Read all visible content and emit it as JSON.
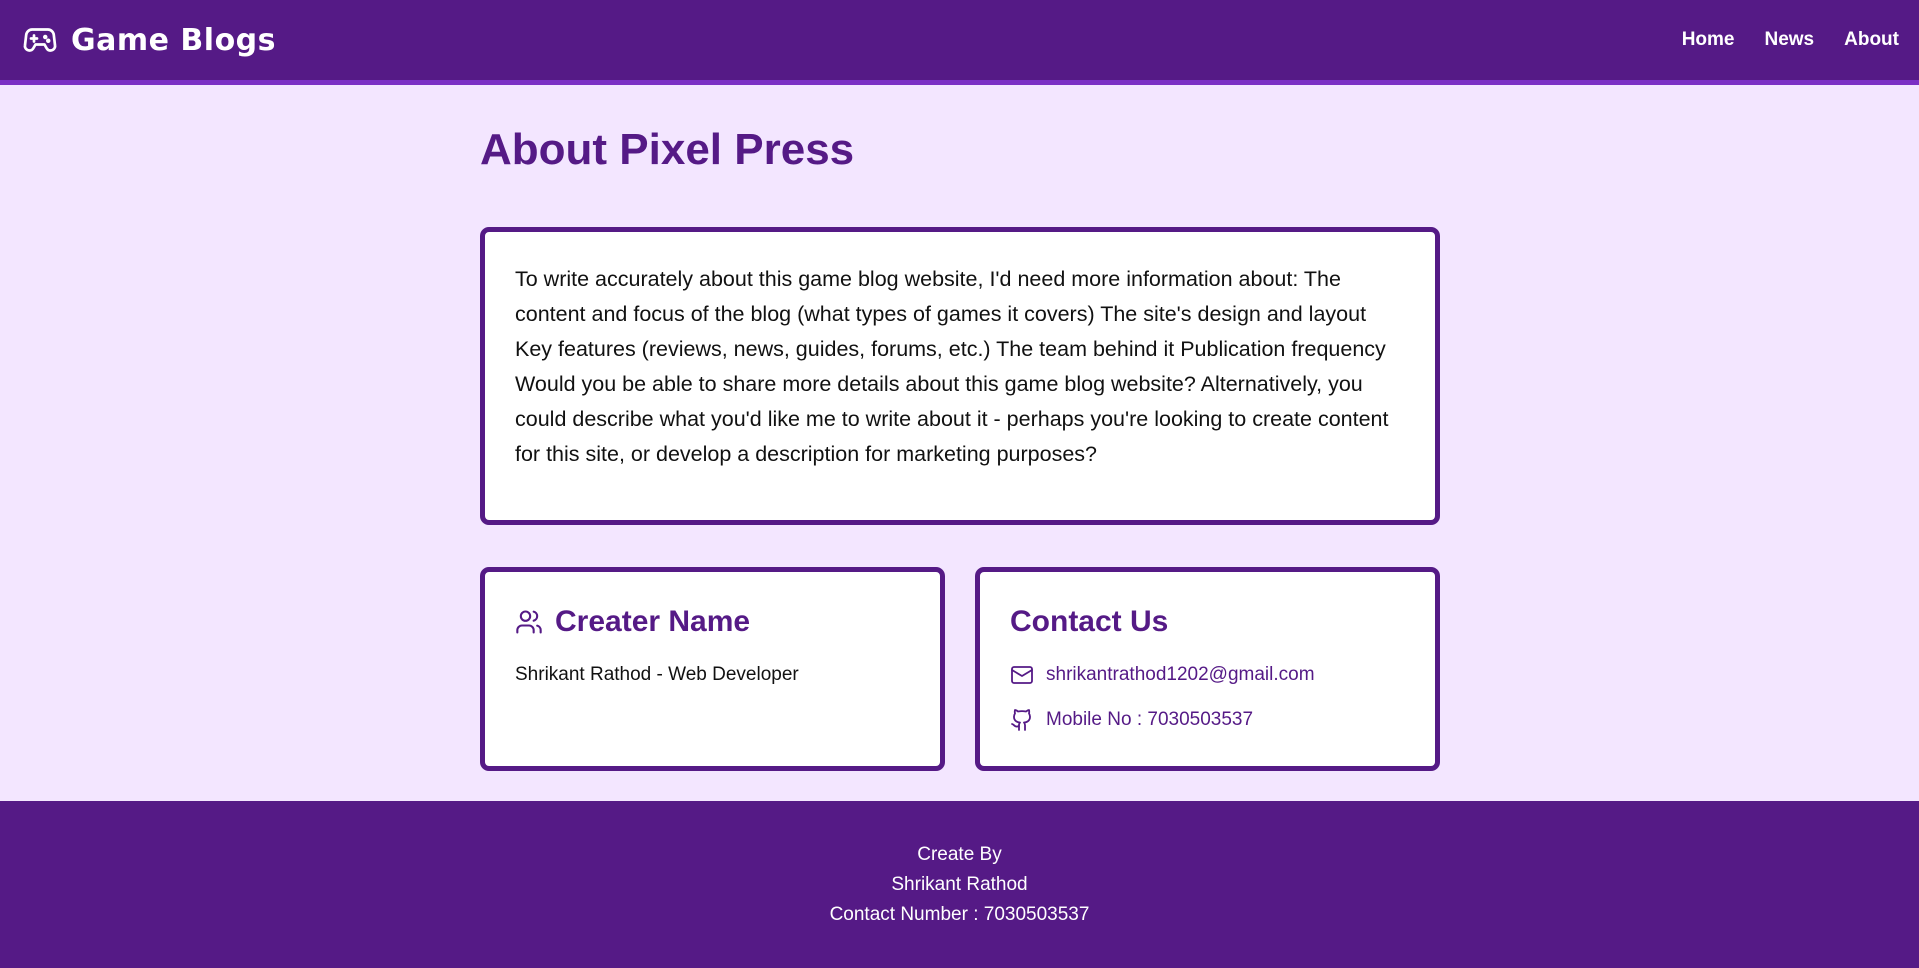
{
  "header": {
    "brand_icon": "gamepad-icon",
    "brand_title": "Game Blogs",
    "nav": [
      {
        "label": "Home"
      },
      {
        "label": "News"
      },
      {
        "label": "About"
      }
    ]
  },
  "main": {
    "title": "About Pixel Press",
    "about_text": "To write accurately about this game blog website, I'd need more information about: The content and focus of the blog (what types of games it covers) The site's design and layout Key features (reviews, news, guides, forums, etc.) The team behind it Publication frequency Would you be able to share more details about this game blog website? Alternatively, you could describe what you'd like me to write about it - perhaps you're looking to create content for this site, or develop a description for marketing purposes?",
    "creator": {
      "icon": "users-icon",
      "title": "Creater Name",
      "text": "Shrikant Rathod - Web Developer"
    },
    "contact": {
      "title": "Contact Us",
      "items": [
        {
          "icon": "mail-icon",
          "text": "shrikantrathod1202@gmail.com"
        },
        {
          "icon": "github-icon",
          "text": "Mobile No : 7030503537"
        }
      ]
    }
  },
  "footer": {
    "line1": "Create By",
    "line2": "Shrikant Rathod",
    "line3": "Contact Number : 7030503537"
  },
  "colors": {
    "primary": "#551a86",
    "accent_border": "#7a2fc4",
    "background": "#f3e6ff",
    "card": "#ffffff"
  }
}
